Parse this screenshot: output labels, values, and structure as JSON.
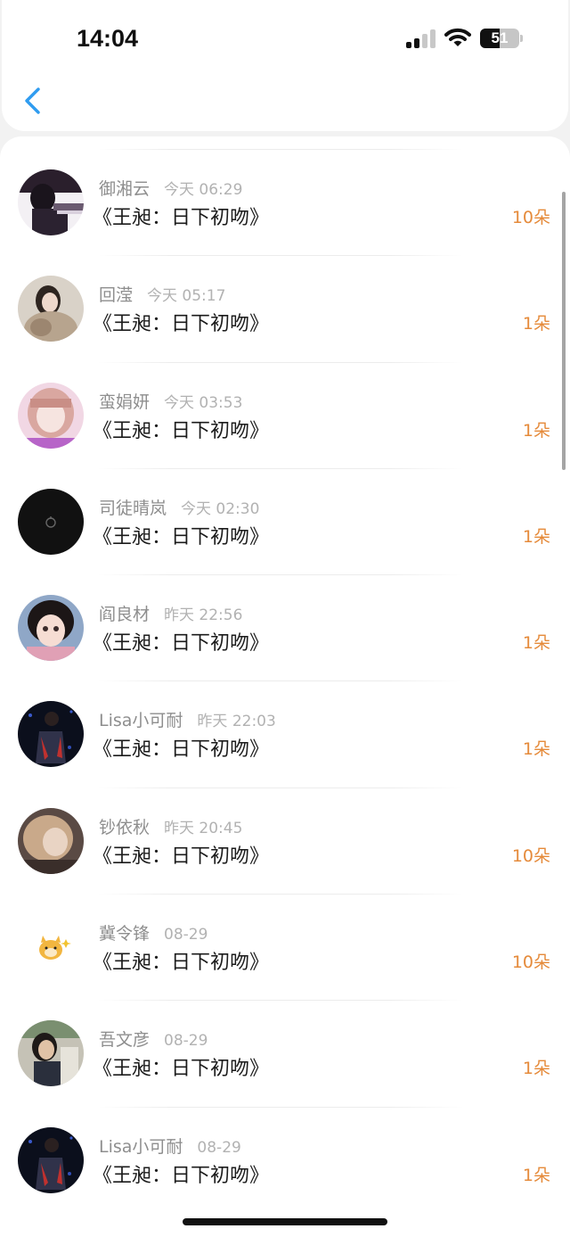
{
  "status_bar": {
    "time": "14:04",
    "battery": "51",
    "battery_level": 0.51,
    "signal_bars": 2
  },
  "nav": {
    "back_icon": "chevron-left-icon",
    "accent": "#2f9cf0"
  },
  "colors": {
    "gift": "#e58a3a",
    "name": "#8e8e8e",
    "time": "#b2b2b2",
    "title": "#1b1b1b"
  },
  "items": [
    {
      "name": "御湘云",
      "time": "今天 06:29",
      "title": "《王昶：日下初吻》",
      "gift": "10朵",
      "avatar": "piano-avatar"
    },
    {
      "name": "回滢",
      "time": "今天 05:17",
      "title": "《王昶：日下初吻》",
      "gift": "1朵",
      "avatar": "fur-coat-avatar"
    },
    {
      "name": "蛮娟妍",
      "time": "今天 03:53",
      "title": "《王昶：日下初吻》",
      "gift": "1朵",
      "avatar": "pink-hair-avatar"
    },
    {
      "name": "司徒晴岚",
      "time": "今天 02:30",
      "title": "《王昶：日下初吻》",
      "gift": "1朵",
      "avatar": "black-avatar"
    },
    {
      "name": "阎良材",
      "time": "昨天 22:56",
      "title": "《王昶：日下初吻》",
      "gift": "1朵",
      "avatar": "anime-girl-avatar"
    },
    {
      "name": "Lisa小可耐",
      "time": "昨天 22:03",
      "title": "《王昶：日下初吻》",
      "gift": "1朵",
      "avatar": "singer-avatar"
    },
    {
      "name": "钞依秋",
      "time": "昨天 20:45",
      "title": "《王昶：日下初吻》",
      "gift": "10朵",
      "avatar": "blonde-avatar"
    },
    {
      "name": "冀令锋",
      "time": "08-29",
      "title": "《王昶：日下初吻》",
      "gift": "10朵",
      "avatar": "cartoon-dog-avatar"
    },
    {
      "name": "吾文彦",
      "time": "08-29",
      "title": "《王昶：日下初吻》",
      "gift": "1朵",
      "avatar": "outdoor-avatar"
    },
    {
      "name": "Lisa小可耐",
      "time": "08-29",
      "title": "《王昶：日下初吻》",
      "gift": "1朵",
      "avatar": "singer-avatar"
    }
  ]
}
